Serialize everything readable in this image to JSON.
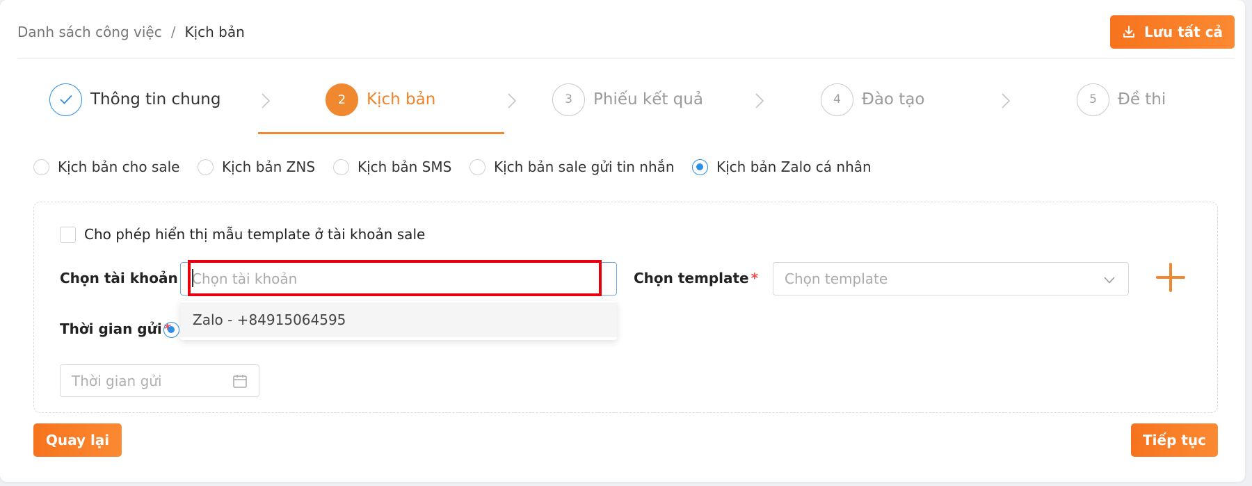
{
  "breadcrumb": {
    "parent": "Danh sách công việc",
    "separator": "/",
    "current": "Kịch bản"
  },
  "header": {
    "save_all_label": "Lưu tất cả"
  },
  "steps": [
    {
      "number": "✓",
      "label": "Thông tin chung",
      "state": "done"
    },
    {
      "number": "2",
      "label": "Kịch bản",
      "state": "active"
    },
    {
      "number": "3",
      "label": "Phiếu kết quả",
      "state": "pending"
    },
    {
      "number": "4",
      "label": "Đào tạo",
      "state": "pending"
    },
    {
      "number": "5",
      "label": "Đề thi",
      "state": "pending"
    }
  ],
  "script_types": {
    "options": [
      "Kịch bản cho sale",
      "Kịch bản ZNS",
      "Kịch bản SMS",
      "Kịch bản sale gửi tin nhắn",
      "Kịch bản Zalo cá nhân"
    ],
    "selected": "Kịch bản Zalo cá nhân"
  },
  "form": {
    "allow_template_label": "Cho phép hiển thị mẫu template ở tài khoản sale",
    "allow_template_checked": false,
    "account_label": "Chọn tài khoản",
    "account_placeholder": "Chọn tài khoản",
    "account_options": [
      "Zalo - +84915064595"
    ],
    "template_label": "Chọn template",
    "template_placeholder": "Chọn template",
    "send_time_label": "Thời gian gửi",
    "send_time_placeholder": "Thời gian gửi",
    "required_mark": "*"
  },
  "footer": {
    "back_label": "Quay lại",
    "next_label": "Tiếp tục"
  },
  "colors": {
    "accent": "#f0882f",
    "primary_blue": "#2b8fe6",
    "required": "#f04b4b",
    "highlight_frame": "#e8000e"
  }
}
